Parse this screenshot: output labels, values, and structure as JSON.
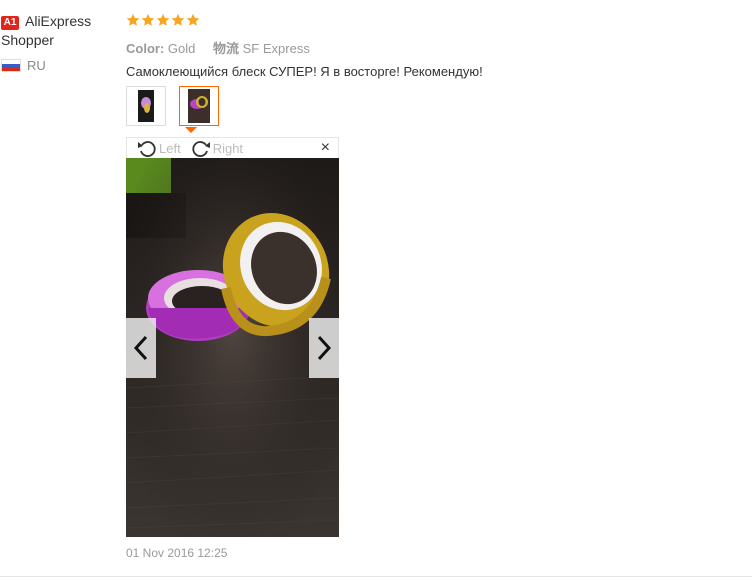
{
  "reviewer": {
    "badge": "A1",
    "name": "AliExpress Shopper",
    "country": "RU"
  },
  "review": {
    "rating": 5,
    "color_label": "Color:",
    "color_value": "Gold",
    "shipping_label": "物流",
    "shipping_value": "SF Express",
    "text": "Самоклеющийся блеск СУПЕР! Я в восторге! Рекомендую!",
    "date": "01 Nov 2016 12:25"
  },
  "viewer": {
    "rotate_left": "Left",
    "rotate_right": "Right",
    "close": "×"
  },
  "colors": {
    "star": "#f6a623",
    "active_border": "#ff6600",
    "badge": "#e1251b"
  }
}
